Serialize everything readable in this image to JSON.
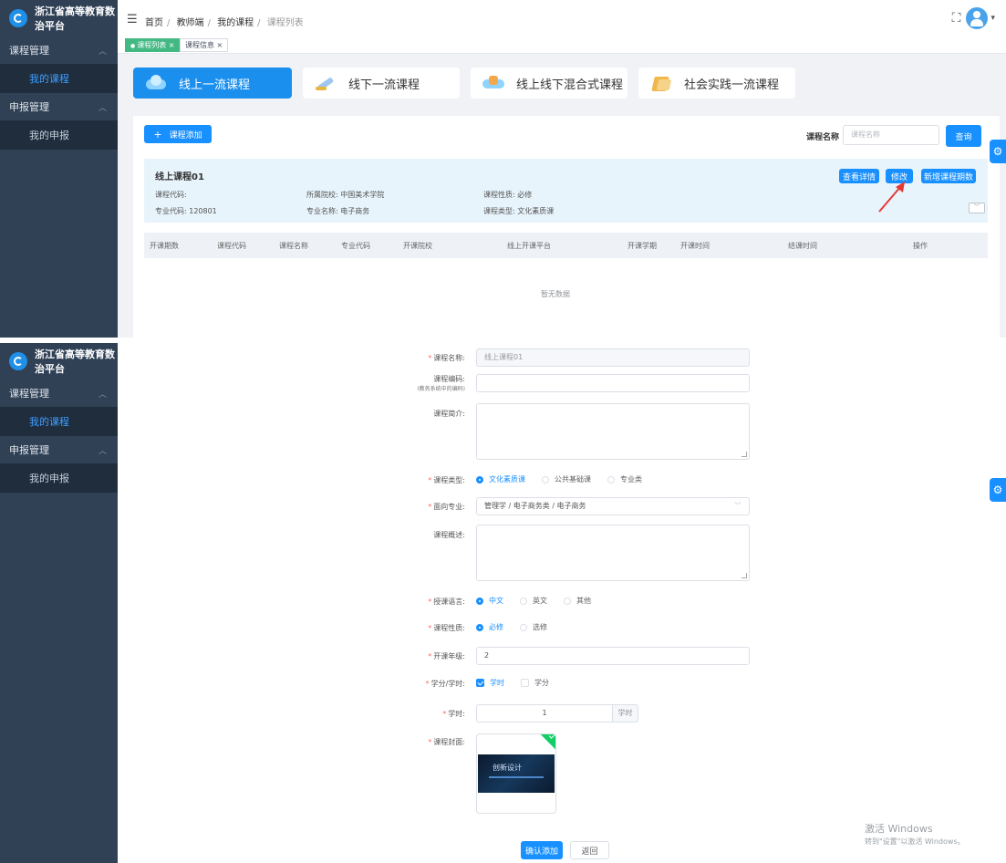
{
  "app": {
    "title": "浙江省高等教育数治平台"
  },
  "sidebar": {
    "groups": [
      {
        "label": "课程管理",
        "items": [
          {
            "label": "我的课程",
            "active": true
          }
        ]
      },
      {
        "label": "申报管理",
        "items": [
          {
            "label": "我的申报",
            "active": false
          }
        ]
      }
    ]
  },
  "breadcrumb": {
    "items": [
      "首页",
      "教师端",
      "我的课程",
      "课程列表"
    ]
  },
  "tags": [
    {
      "label": "课程列表 ×",
      "active": true
    },
    {
      "label": "课程信息 ×",
      "active": false
    }
  ],
  "course_tabs": [
    {
      "label": "线上一流课程",
      "icon": "cloud-icon",
      "active": true
    },
    {
      "label": "线下一流课程",
      "icon": "pen-icon",
      "active": false
    },
    {
      "label": "线上线下混合式课程",
      "icon": "mixed-icon",
      "active": false
    },
    {
      "label": "社会实践一流课程",
      "icon": "book-icon",
      "active": false
    }
  ],
  "toolbar": {
    "add_label": "课程添加",
    "search_label": "课程名称",
    "search_placeholder": "课程名称",
    "search_button": "查询"
  },
  "course": {
    "title": "线上课程01",
    "code_label": "课程代码:",
    "major_code": "专业代码: 120801",
    "school": "所属院校: 中国美术学院",
    "major_name": "专业名称: 电子商务",
    "nature": "课程性质: 必修",
    "type": "课程类型: 文化素质课",
    "actions": [
      "查看详情",
      "修改",
      "新增课程期数"
    ]
  },
  "table": {
    "columns": [
      "开课期数",
      "课程代码",
      "课程名称",
      "专业代码",
      "开课院校",
      "线上开课平台",
      "开课学期",
      "开课时间",
      "结课时间",
      "操作"
    ],
    "empty_text": "暂无数据"
  },
  "form": {
    "course_name": {
      "label": "课程名称:",
      "value": "线上课程01"
    },
    "course_number": {
      "label": "课程编码:",
      "sub": "(教务系统中的编码)",
      "value": ""
    },
    "intro": {
      "label": "课程简介:"
    },
    "type": {
      "label": "课程类型:",
      "options": [
        "文化素质课",
        "公共基础课",
        "专业类"
      ],
      "selected": 0
    },
    "major": {
      "label": "面向专业:",
      "value": "管理学 / 电子商务类 / 电子商务"
    },
    "summary": {
      "label": "课程概述:"
    },
    "language": {
      "label": "授课语言:",
      "options": [
        "中文",
        "英文",
        "其他"
      ],
      "selected": 0
    },
    "nature": {
      "label": "课程性质:",
      "options": [
        "必修",
        "选修"
      ],
      "selected": 0
    },
    "grade": {
      "label": "开课年级:",
      "value": "2"
    },
    "credit_hours": {
      "label": "学分/学时:",
      "options": [
        "学时",
        "学分"
      ],
      "checked": [
        true,
        false
      ]
    },
    "hours": {
      "label": "学时:",
      "value": "1",
      "unit": "学时"
    },
    "cover": {
      "label": "课程封面:",
      "image_text": "创新设计"
    },
    "confirm": "确认添加",
    "back": "返回"
  },
  "watermark": {
    "line1": "激活 Windows",
    "line2": "转到\"设置\"以激活 Windows。"
  },
  "colors": {
    "primary": "#1890ff",
    "sidebar": "#304156",
    "tag_active": "#42b983",
    "required": "#f56c6c"
  }
}
